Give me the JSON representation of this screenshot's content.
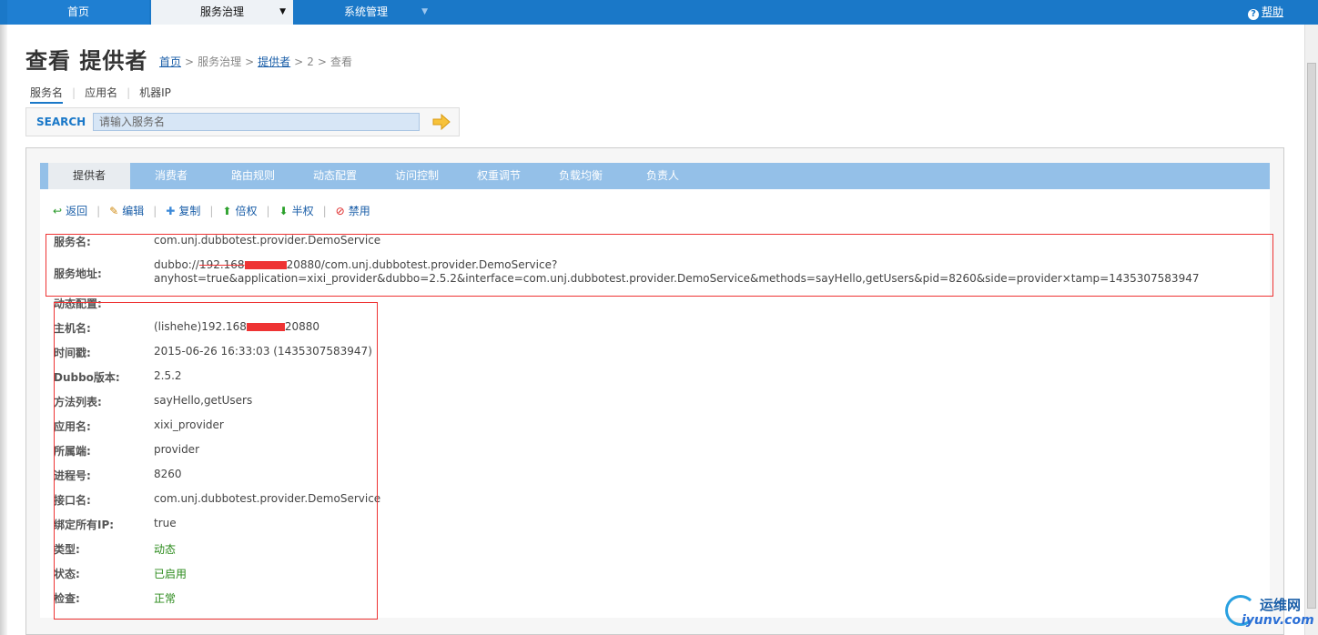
{
  "topnav": {
    "home": "首页",
    "service_governance": "服务治理",
    "system_management": "系统管理",
    "help": "帮助",
    "help_icon": "?"
  },
  "header": {
    "title": "查看 提供者",
    "breadcrumb": {
      "home": "首页",
      "governance": "服务治理",
      "provider": "提供者",
      "id": "2",
      "view": "查看",
      "separator": ">"
    }
  },
  "search": {
    "tabs": [
      "服务名",
      "应用名",
      "机器IP"
    ],
    "active_tab": 0,
    "label": "SEARCH",
    "placeholder": "请输入服务名"
  },
  "tabs": [
    "提供者",
    "消费者",
    "路由规则",
    "动态配置",
    "访问控制",
    "权重调节",
    "负载均衡",
    "负责人"
  ],
  "toolbar": {
    "back": "返回",
    "edit": "编辑",
    "copy": "复制",
    "double_weight": "倍权",
    "half_weight": "半权",
    "disable": "禁用"
  },
  "detail": {
    "service_name_label": "服务名:",
    "service_name": "com.unj.dubbotest.provider.DemoService",
    "service_address_label": "服务地址:",
    "service_address_prefix": "dubbo://",
    "service_address_ip_visible": "192.168",
    "service_address_suffix": "20880/com.unj.dubbotest.provider.DemoService?anyhost=true&application=xixi_provider&dubbo=2.5.2&interface=com.unj.dubbotest.provider.DemoService&methods=sayHello,getUsers&pid=8260&side=provider×tamp=1435307583947",
    "fields": [
      {
        "label": "动态配置:",
        "value": ""
      },
      {
        "label": "主机名:",
        "value_prefix": "(lishehe)192.168",
        "value_suffix": "20880"
      },
      {
        "label": "时间戳:",
        "value": "2015-06-26 16:33:03 (1435307583947)"
      },
      {
        "label": "Dubbo版本:",
        "value": "2.5.2"
      },
      {
        "label": "方法列表:",
        "value": "sayHello,getUsers"
      },
      {
        "label": "应用名:",
        "value": "xixi_provider"
      },
      {
        "label": "所属端:",
        "value": "provider"
      },
      {
        "label": "进程号:",
        "value": "8260"
      },
      {
        "label": "接口名:",
        "value": "com.unj.dubbotest.provider.DemoService"
      },
      {
        "label": "绑定所有IP:",
        "value": "true"
      },
      {
        "label": "类型:",
        "value": "动态"
      },
      {
        "label": "状态:",
        "value": "已启用"
      },
      {
        "label": "检查:",
        "value": "正常"
      }
    ]
  },
  "colors": {
    "nav_blue": "#1a78c8",
    "tab_blue": "#94c0e8",
    "link_blue": "#1a5ea8",
    "status_green": "#2a8a1a",
    "annotation_red": "#ee3333"
  },
  "watermark": {
    "cn": "运维网",
    "en": "iyunv.com"
  }
}
